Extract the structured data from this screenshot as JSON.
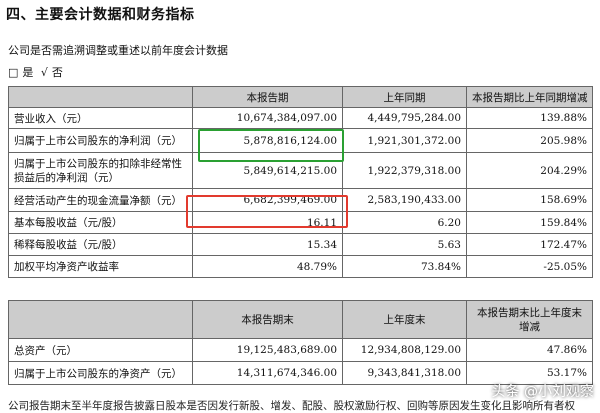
{
  "section_title": "四、主要会计数据和财务指标",
  "question": "公司是否需追溯调整或重述以前年度会计数据",
  "answer": {
    "option_yes_box": "□",
    "option_yes": "是",
    "option_no_check": "√",
    "option_no": "否"
  },
  "table1": {
    "headers": [
      "",
      "本报告期",
      "上年同期",
      "本报告期比上年同期增减"
    ],
    "rows": [
      {
        "label": "营业收入（元）",
        "current": "10,674,384,097.00",
        "prior": "4,449,795,284.00",
        "change": "139.88%"
      },
      {
        "label": "归属于上市公司股东的净利润（元）",
        "current": "5,878,816,124.00",
        "prior": "1,921,301,372.00",
        "change": "205.98%"
      },
      {
        "label": "归属于上市公司股东的扣除非经常性损益后的净利润（元）",
        "current": "5,849,614,215.00",
        "prior": "1,922,379,318.00",
        "change": "204.29%"
      },
      {
        "label": "经营活动产生的现金流量净额（元）",
        "current": "6,682,399,469.00",
        "prior": "2,583,190,433.00",
        "change": "158.69%"
      },
      {
        "label": "基本每股收益（元/股）",
        "current": "16.11",
        "prior": "6.20",
        "change": "159.84%"
      },
      {
        "label": "稀释每股收益（元/股）",
        "current": "15.34",
        "prior": "5.63",
        "change": "172.47%"
      },
      {
        "label": "加权平均净资产收益率",
        "current": "48.79%",
        "prior": "73.84%",
        "change": "-25.05%"
      }
    ]
  },
  "table2": {
    "headers": [
      "",
      "本报告期末",
      "上年度末",
      "本报告期末比上年度末增减"
    ],
    "rows": [
      {
        "label": "总资产（元）",
        "current": "19,125,483,689.00",
        "prior": "12,934,808,129.00",
        "change": "47.86%"
      },
      {
        "label": "归属于上市公司股东的净资产（元）",
        "current": "14,311,674,346.00",
        "prior": "9,343,841,318.00",
        "change": "53.17%"
      }
    ]
  },
  "watermark": "头条 @小刘观察",
  "footer_text": "公司报告期末至半年度报告披露日股本是否因发行新股、增发、配股、股权激励行权、回购等原因发生变化且影响所有者权"
}
